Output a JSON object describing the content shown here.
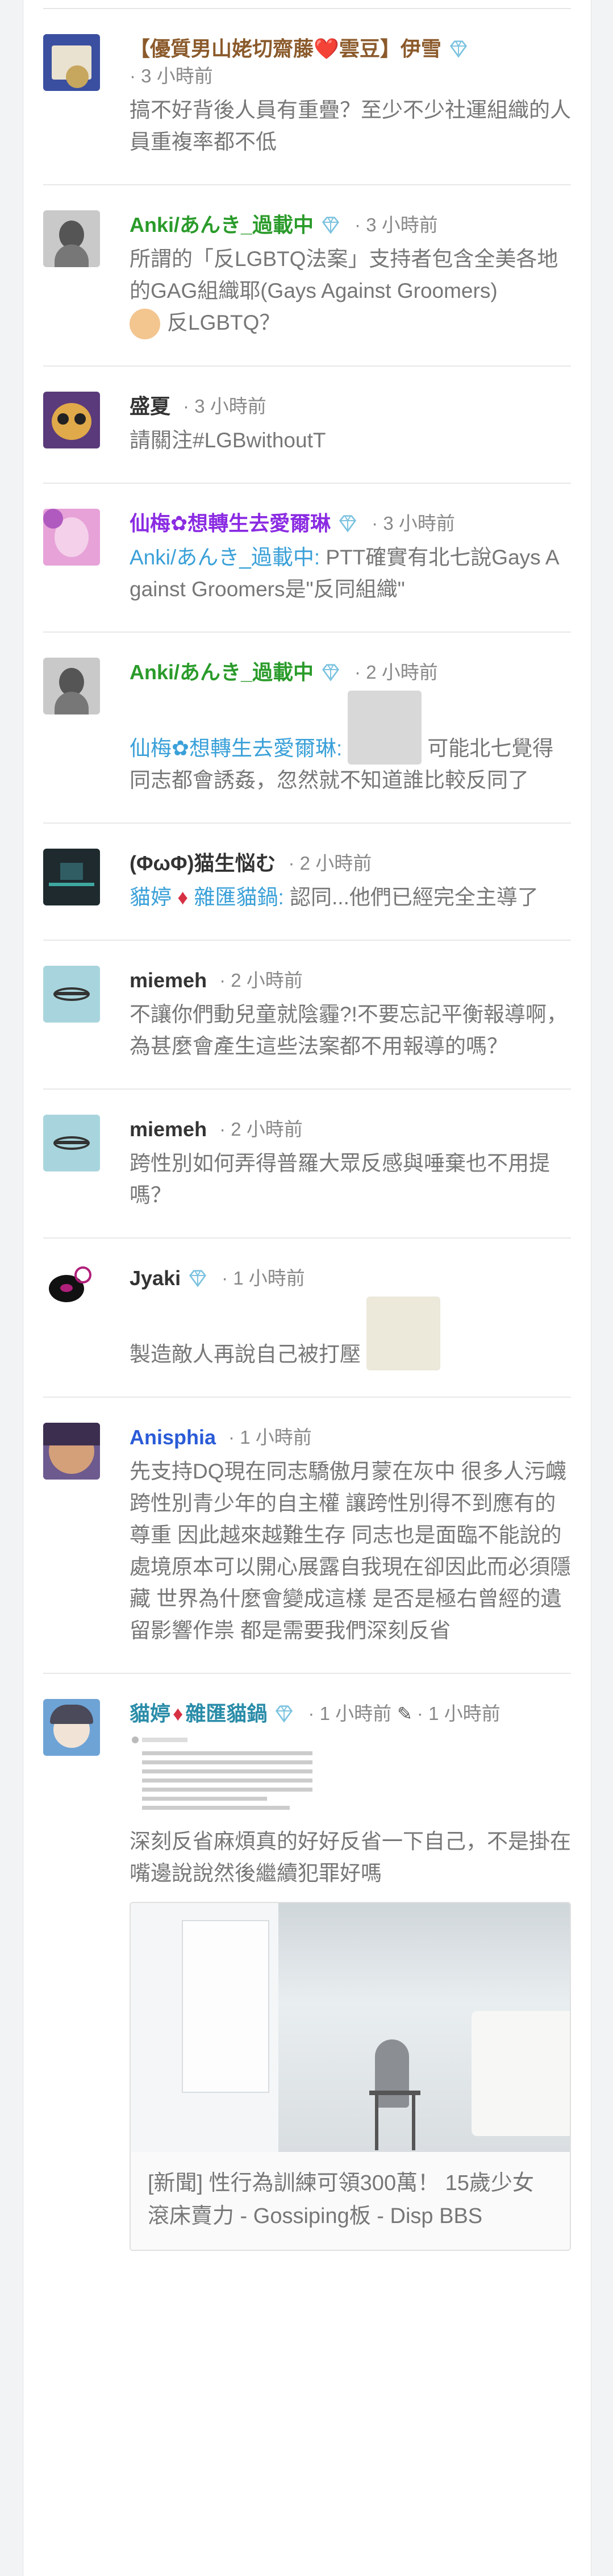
{
  "comments": [
    {
      "name": "【優質男山姥切齋藤❤️雲豆】伊雪",
      "time": "3 小時前",
      "text": "搞不好背後人員有重疊？至少不少社運組織的人員重複率都不低"
    },
    {
      "name": "Anki/あんき_過載中",
      "time": "3 小時前",
      "text": "所謂的「反LGBTQ法案」支持者包含全美各地的GAG組織耶(Gays Against Groomers)",
      "text2": "反LGBTQ？"
    },
    {
      "name": "盛夏",
      "time": "3 小時前",
      "text": "請關注#LGBwithoutT"
    },
    {
      "name": "仙梅✿想轉生去愛爾琳",
      "time": "3 小時前",
      "mention": "Anki/あんき_過載中:",
      "text": " PTT確實有北七說Gays Against Groomers是\"反同組織\""
    },
    {
      "name": "Anki/あんき_過載中",
      "time": "2 小時前",
      "mention": "仙梅✿想轉生去愛爾琳:",
      "text": "可能北七覺得同志都會誘姦，忽然就不知道誰比較反同了"
    },
    {
      "name": "(ΦωΦ)猫生悩む",
      "time": "2 小時前",
      "mention": "貓婷",
      "mention2": "雜匯貓鍋:",
      "text": " 認同...他們已經完全主導了"
    },
    {
      "name": "miemeh",
      "time": "2 小時前",
      "text": "不讓你們動兒童就陰霾?!不要忘記平衡報導啊，為甚麼會產生這些法案都不用報導的嗎？"
    },
    {
      "name": "miemeh",
      "time": "2 小時前",
      "text": "跨性別如何弄得普羅大眾反感與唾棄也不用提嗎？"
    },
    {
      "name": "Jyaki",
      "time": "1 小時前",
      "text": "製造敵人再說自己被打壓"
    },
    {
      "name": "Anisphia",
      "time": "1 小時前",
      "text": "先支持DQ現在同志驕傲月蒙在灰中 很多人污衊跨性別青少年的自主權 讓跨性別得不到應有的尊重 因此越來越難生存 同志也是面臨不能說的處境原本可以開心展露自我現在卻因此而必須隱藏 世界為什麼會變成這樣 是否是極右曾經的遺留影響作祟 都是需要我們深刻反省"
    },
    {
      "name": "貓婷",
      "name2": "雜匯貓鍋",
      "time": "1 小時前",
      "edited": "1 小時前",
      "text": "深刻反省麻煩真的好好反省一下自己，不是掛在嘴邊說說然後繼續犯罪好嗎",
      "card_title": "[新聞] 性行為訓練可領300萬！ 15歲少女滾床賣力 - Gossiping板 - Disp BBS"
    }
  ],
  "colors": {
    "accent_green": "#2a9b2a",
    "mention_blue": "#3aa0d8",
    "heart_red": "#d63043",
    "muted_text": "#777777"
  },
  "icons": [
    "diamond-badge-icon",
    "pencil-icon",
    "heart-icon"
  ]
}
